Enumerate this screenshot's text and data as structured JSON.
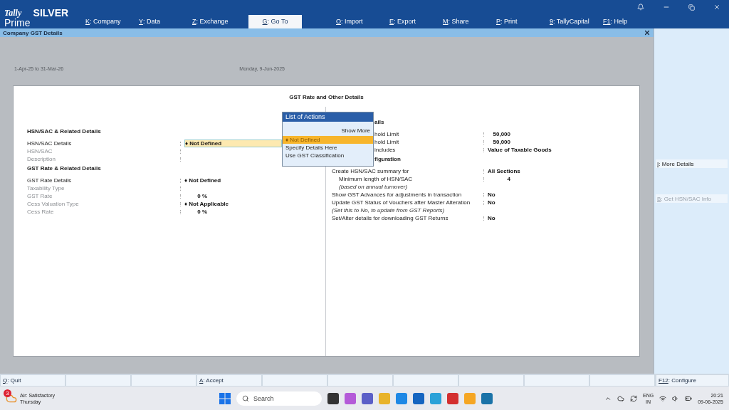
{
  "brand": {
    "top": "Tally",
    "bottom": "Prime",
    "edition": "SILVER"
  },
  "menu": [
    {
      "key": "K",
      "label": ": Company",
      "selected": false
    },
    {
      "key": "Y",
      "label": ": Data",
      "selected": false
    },
    {
      "key": "Z",
      "label": ": Exchange",
      "selected": false
    },
    {
      "key": "G",
      "label": ": Go To",
      "selected": true
    },
    {
      "key": "O",
      "label": ": Import",
      "selected": false
    },
    {
      "key": "E",
      "label": ": Export",
      "selected": false
    },
    {
      "key": "M",
      "label": ": Share",
      "selected": false
    },
    {
      "key": "P",
      "label": ": Print",
      "selected": false
    },
    {
      "key": "9",
      "label": ": TallyCapital",
      "selected": false
    },
    {
      "key": "F1",
      "label": ": Help",
      "selected": false
    }
  ],
  "screen_title": "Company GST Details",
  "background_info": {
    "period": "1-Apr-25 to 31-Mar-26",
    "date": "Monday, 9-Jun-2025"
  },
  "form": {
    "title": "GST Rate and Other Details",
    "left": [
      {
        "kind": "heading",
        "label": "HSN/SAC & Related Details"
      },
      {
        "kind": "field",
        "label": "HSN/SAC Details",
        "value": "♦ Not Defined",
        "active": true,
        "disabled": false
      },
      {
        "kind": "field",
        "label": "HSN/SAC",
        "disabled": true
      },
      {
        "kind": "field",
        "label": "Description",
        "disabled": true
      },
      {
        "kind": "heading",
        "label": "GST Rate & Related Details"
      },
      {
        "kind": "field",
        "label": "GST Rate Details",
        "value": "♦ Not Defined",
        "active": false,
        "disabled": false
      },
      {
        "kind": "field",
        "label": "Taxability Type",
        "disabled": true
      },
      {
        "kind": "field",
        "label": "GST Rate",
        "value": "0 %",
        "number": true,
        "disabled": true
      },
      {
        "kind": "field",
        "label": "Cess Valuation Type",
        "value": "♦ Not Applicable",
        "number": false,
        "disabled": true
      },
      {
        "kind": "field",
        "label": "Cess Rate",
        "value": "0 %",
        "number": true,
        "disabled": true
      }
    ],
    "right": [
      {
        "kind": "heading",
        "label": "ails"
      },
      {
        "kind": "field",
        "label": "hold Limit",
        "value": "50,000",
        "number": true
      },
      {
        "kind": "field",
        "label": "hold Limit",
        "value": "50,000",
        "number": true
      },
      {
        "kind": "field",
        "label": "includes",
        "value": "Value of Taxable Goods",
        "number": false
      },
      {
        "kind": "heading",
        "label": "figuration"
      },
      {
        "kind": "field",
        "label": "Create HSN/SAC summary for",
        "value": "All Sections",
        "number": false
      },
      {
        "kind": "field",
        "label": "Minimum length of HSN/SAC",
        "value": "4",
        "number": true,
        "indented": true
      },
      {
        "kind": "note",
        "label": "(based on annual turnover)",
        "indented": true
      },
      {
        "kind": "field",
        "label": "Show GST Advances for adjustments in transaction",
        "value": "No",
        "number": false
      },
      {
        "kind": "field",
        "label": "Update GST Status of Vouchers after Master Alteration",
        "value": "No",
        "number": false
      },
      {
        "kind": "note",
        "label": "(Set this to No, to update from GST Reports)",
        "indented": false
      },
      {
        "kind": "field",
        "label": "Set/Alter details for downloading GST Returns",
        "value": "No",
        "number": false
      }
    ]
  },
  "list_of_actions": {
    "title": "List of Actions",
    "show_more": "Show More",
    "items": [
      {
        "label": "♦ Not Defined",
        "selected": true
      },
      {
        "label": "Specify Details Here",
        "selected": false
      },
      {
        "label": "Use GST Classification",
        "selected": false
      }
    ]
  },
  "side_buttons": [
    {
      "key": "I",
      "label": ": More Details",
      "disabled": false
    },
    {
      "key": "B",
      "label": ": Get HSN/SAC Info",
      "disabled": true
    }
  ],
  "bottom_buttons": [
    {
      "kind": "action",
      "key": "Q",
      "label": ": Quit"
    },
    {
      "kind": "empty"
    },
    {
      "kind": "empty"
    },
    {
      "kind": "action",
      "key": "A",
      "label": ": Accept"
    },
    {
      "kind": "empty"
    },
    {
      "kind": "empty"
    },
    {
      "kind": "empty"
    },
    {
      "kind": "empty"
    },
    {
      "kind": "empty"
    },
    {
      "kind": "empty"
    }
  ],
  "configure_button": {
    "key": "F12",
    "label": ": Configure"
  },
  "taskbar": {
    "weather_badge": "3",
    "weather": "Air: Satisfactory",
    "day": "Thursday",
    "search": "Search",
    "language": "ENG",
    "region": "IN",
    "time": "20:21",
    "date": "09-06-2025"
  }
}
